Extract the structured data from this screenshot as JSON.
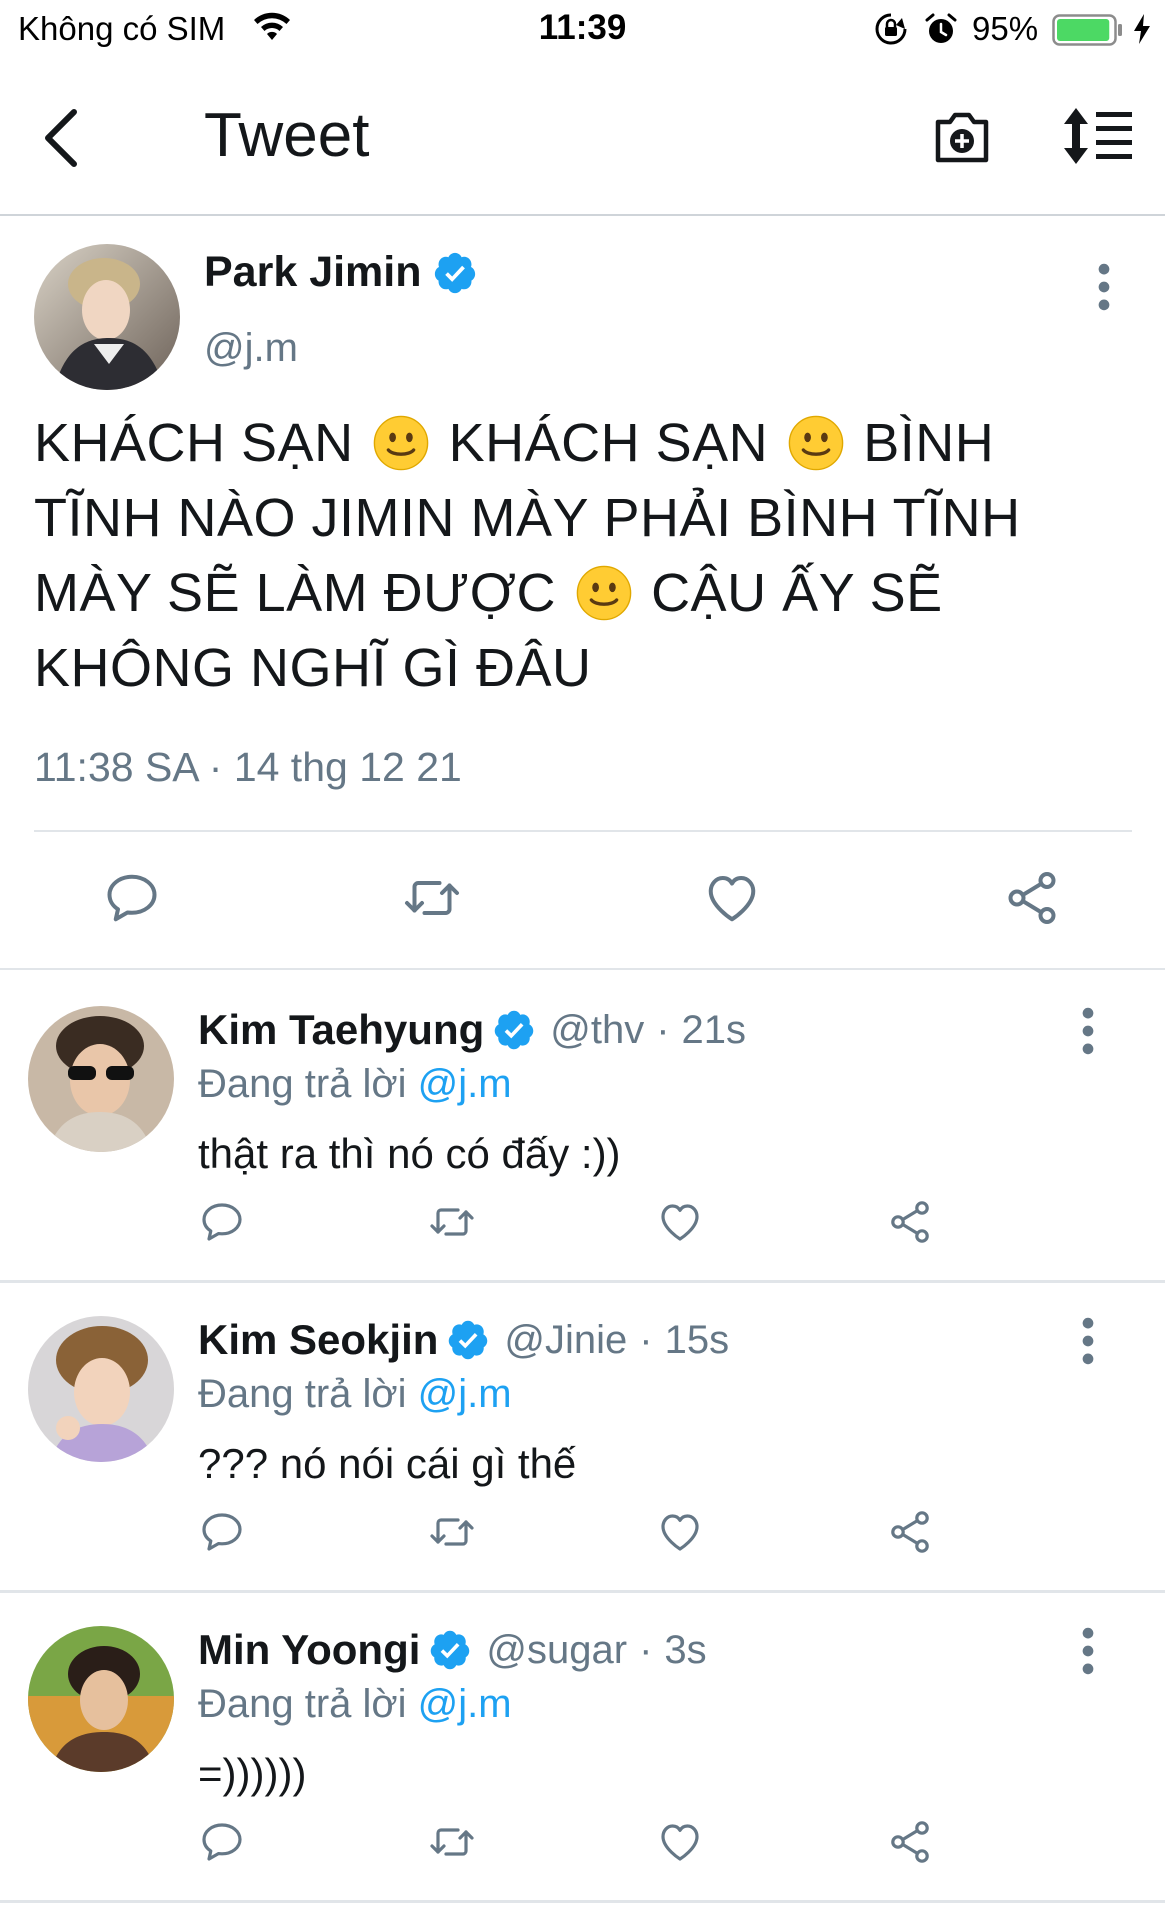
{
  "status_bar": {
    "carrier": "Không có SIM",
    "time": "11:39",
    "battery_percent": "95%",
    "battery_level": 0.95,
    "battery_color": "#4cd964"
  },
  "nav": {
    "title": "Tweet",
    "back_icon": "chevron-left-icon",
    "camera_icon": "camera-plus-icon",
    "sort_icon": "sort-list-icon"
  },
  "main_tweet": {
    "name": "Park Jimin",
    "handle": "@j.m",
    "text_parts": [
      "KHÁCH SẠN",
      "KHÁCH SẠN",
      "BÌNH TĨNH NÀO JIMIN MÀY PHẢI BÌNH TĨNH MÀY SẼ LÀM ĐƯỢC",
      "CẬU ẤY SẼ KHÔNG NGHĨ GÌ ĐÂU"
    ],
    "timestamp": "11:38 SA · 14 thg 12 21"
  },
  "replies": [
    {
      "name": "Kim Taehyung",
      "handle": "@thv",
      "dot": "·",
      "time": "21s",
      "replying_prefix": "Đang trả lời",
      "mention": "@j.m",
      "text": "thật ra thì nó có đấy :))"
    },
    {
      "name": "Kim Seokjin",
      "handle": "@Jinie",
      "dot": "·",
      "time": "15s",
      "replying_prefix": "Đang trả lời",
      "mention": "@j.m",
      "text": "??? nó nói cái gì thế"
    },
    {
      "name": "Min Yoongi",
      "handle": "@sugar",
      "dot": "·",
      "time": "3s",
      "replying_prefix": "Đang trả lời",
      "mention": "@j.m",
      "text": "=))))))"
    }
  ],
  "colors": {
    "accent": "#1da1f2",
    "secondary_text": "#657786",
    "primary_text": "#14171a",
    "action_icon": "#657786"
  }
}
